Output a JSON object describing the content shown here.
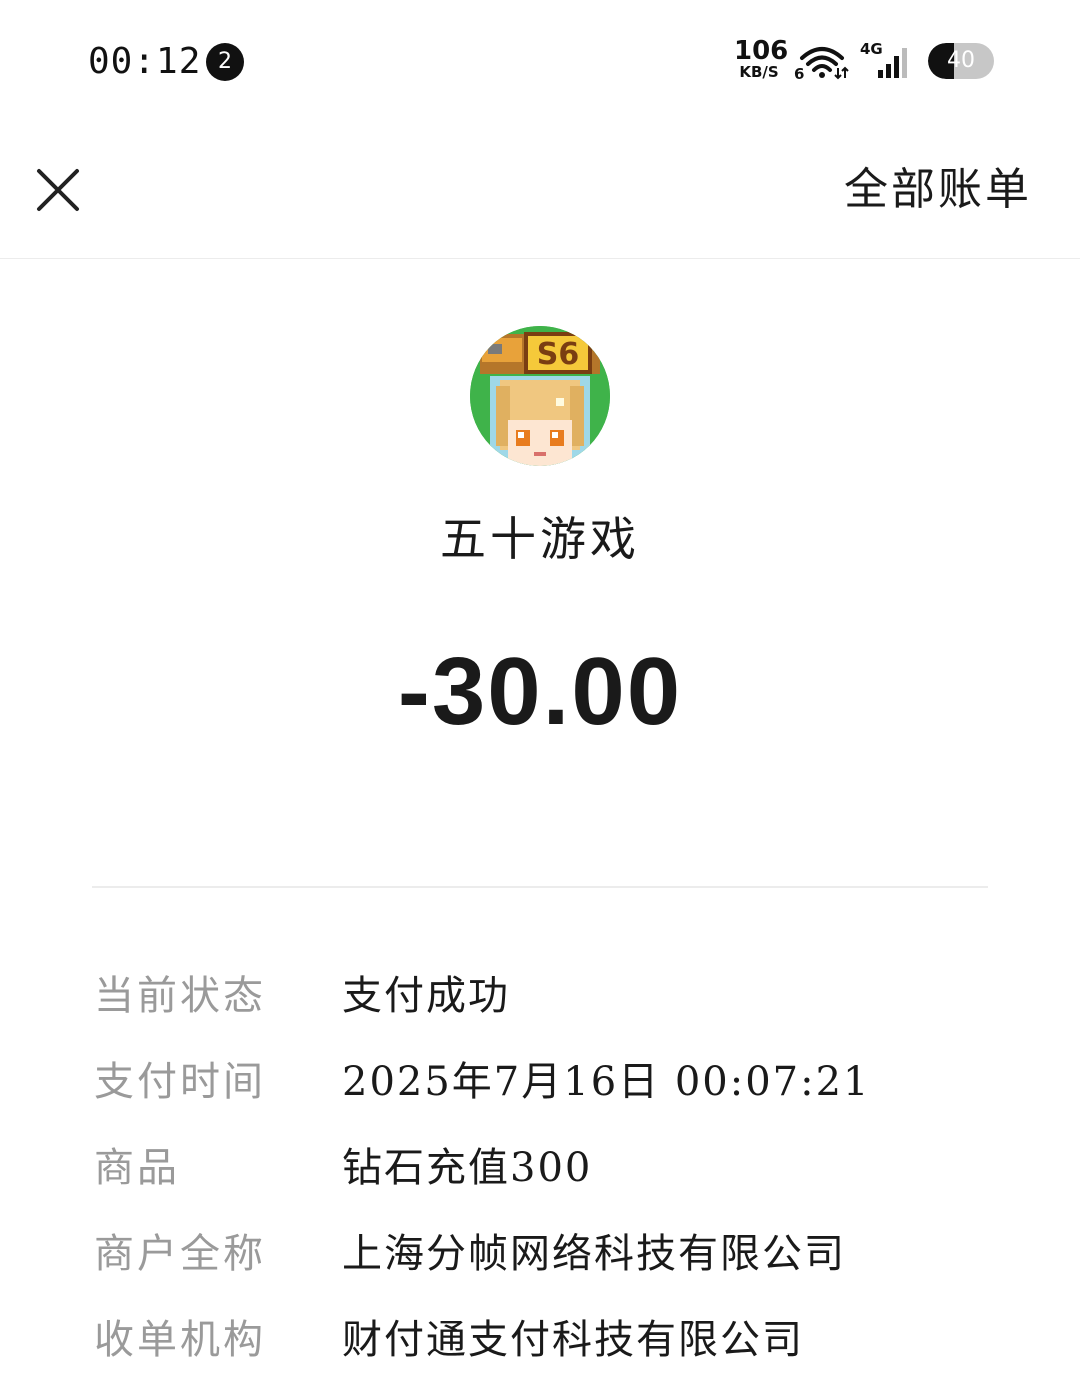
{
  "status_bar": {
    "time": "00:12",
    "notification_count": "2",
    "net_speed_value": "106",
    "net_speed_unit": "KB/S",
    "wifi_label": "6",
    "network_type": "4G",
    "battery_level": "40"
  },
  "nav": {
    "close_icon": "close-icon",
    "all_bills_label": "全部账单"
  },
  "merchant": {
    "avatar_badge": "S6",
    "name": "五十游戏",
    "amount": "-30.00"
  },
  "details": [
    {
      "label": "当前状态",
      "value": "支付成功"
    },
    {
      "label": "支付时间",
      "value": "2025年7月16日 00:07:21"
    },
    {
      "label": "商品",
      "value": "钻石充值300"
    },
    {
      "label": "商户全称",
      "value": "上海分帧网络科技有限公司"
    },
    {
      "label": "收单机构",
      "value": "财付通支付科技有限公司"
    }
  ],
  "colors": {
    "background": "#ffffff",
    "text_primary": "#1a1a1a",
    "text_secondary": "#9a9a9a",
    "divider": "#ececec",
    "avatar_green": "#3fb34a"
  }
}
